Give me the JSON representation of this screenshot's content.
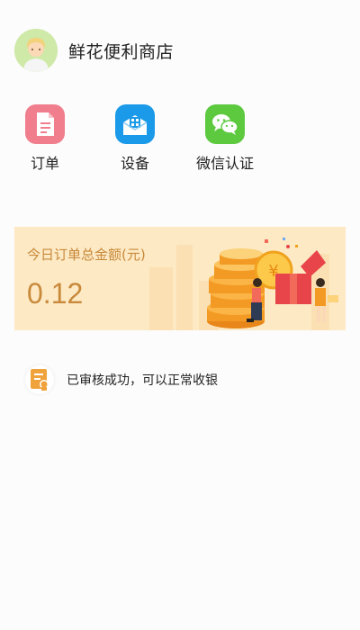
{
  "header": {
    "store_name": "鲜花便利商店",
    "avatar_icon": "user-avatar-icon"
  },
  "actions": [
    {
      "label": "订单",
      "icon": "order-document-icon",
      "color": "#f07e8d"
    },
    {
      "label": "设备",
      "icon": "device-box-icon",
      "color": "#1a9ae8"
    },
    {
      "label": "微信认证",
      "icon": "wechat-icon",
      "color": "#5dc93f"
    }
  ],
  "banner": {
    "title": "今日订单总金额(元)",
    "value": "0.12",
    "background": "#fde9c4",
    "text_color": "#c8893a",
    "illustration_icon": "coins-gift-illustration"
  },
  "notice": {
    "text": "已审核成功，可以正常收银",
    "icon": "approved-document-icon",
    "icon_color": "#f0a23c"
  }
}
